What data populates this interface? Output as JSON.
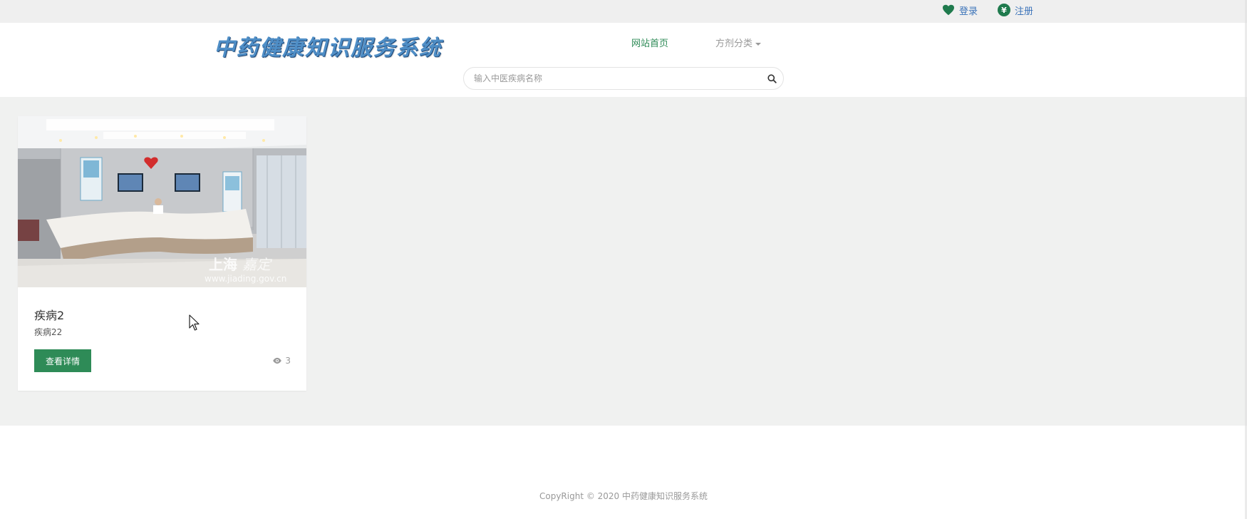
{
  "top_bar": {
    "login_label": "登录",
    "register_label": "注册",
    "login_icon": "heart-icon",
    "register_icon": "yen-icon"
  },
  "header": {
    "logo_text": "中药健康知识服务系统",
    "nav": [
      {
        "label": "网站首页",
        "active": true
      },
      {
        "label": "方剂分类",
        "dropdown": true
      }
    ],
    "search": {
      "placeholder": "输入中医疾病名称",
      "value": "",
      "icon": "search-icon"
    }
  },
  "main": {
    "cards": [
      {
        "title": "疾病2",
        "subtitle": "疾病22",
        "button_label": "查看详情",
        "views": "3",
        "image": {
          "watermark_main": "上海",
          "watermark_mark": "嘉定",
          "watermark_url": "www.jiading.gov.cn"
        }
      }
    ]
  },
  "footer": {
    "copyright": "CopyRight © 2020 中药健康知识服务系统"
  },
  "colors": {
    "accent": "#2e8b57",
    "link": "#3b73b9",
    "logo": "#4f8ec6"
  }
}
